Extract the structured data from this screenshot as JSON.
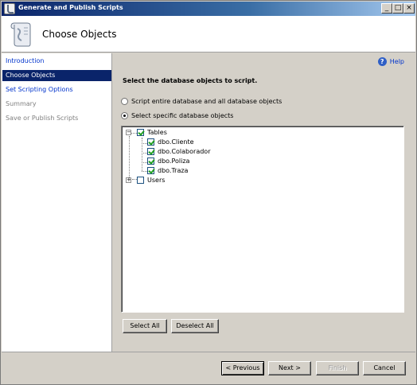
{
  "window": {
    "title": "Generate and Publish Scripts",
    "controls": {
      "minimize": "_",
      "maximize": "□",
      "close": "×"
    }
  },
  "header": {
    "title": "Choose Objects",
    "icon": "script-scroll-icon"
  },
  "nav": {
    "items": [
      {
        "label": "Introduction",
        "state": "link"
      },
      {
        "label": "Choose Objects",
        "state": "active"
      },
      {
        "label": "Set Scripting Options",
        "state": "link"
      },
      {
        "label": "Summary",
        "state": "disabled"
      },
      {
        "label": "Save or Publish Scripts",
        "state": "disabled"
      }
    ]
  },
  "main": {
    "help_label": "Help",
    "instruction": "Select the database objects to script.",
    "radios": [
      {
        "label": "Script entire database and all database objects",
        "checked": false
      },
      {
        "label": "Select specific database objects",
        "checked": true
      }
    ],
    "tree": {
      "tables_label": "Tables",
      "tables": [
        "dbo.Cliente",
        "dbo.Colaborador",
        "dbo.Poliza",
        "dbo.Traza"
      ],
      "users_label": "Users"
    },
    "select_all": "Select All",
    "deselect_all": "Deselect All"
  },
  "footer": {
    "previous": "< Previous",
    "next": "Next >",
    "finish": "Finish",
    "cancel": "Cancel"
  },
  "colors": {
    "title_gradient_start": "#0a246a",
    "nav_active": "#0a246a",
    "link": "#0033cc",
    "check": "#21a121"
  }
}
